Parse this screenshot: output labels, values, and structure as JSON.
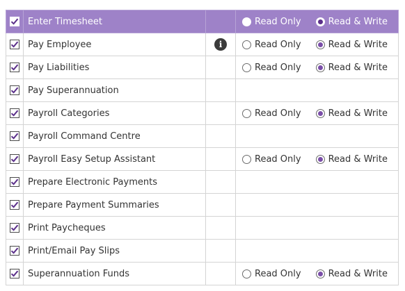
{
  "header": {
    "label": "Enter Timesheet",
    "option_read_only": "Read Only",
    "option_read_write": "Read & Write"
  },
  "info_icon_glyph": "i",
  "rows": [
    {
      "label": "Pay Employee",
      "read_only": "Read Only",
      "read_write": "Read & Write"
    },
    {
      "label": "Pay Liabilities",
      "read_only": "Read Only",
      "read_write": "Read & Write"
    },
    {
      "label": "Pay Superannuation"
    },
    {
      "label": "Payroll Categories",
      "read_only": "Read Only",
      "read_write": "Read & Write"
    },
    {
      "label": "Payroll Command Centre"
    },
    {
      "label": "Payroll Easy Setup Assistant",
      "read_only": "Read Only",
      "read_write": "Read & Write"
    },
    {
      "label": "Prepare Electronic Payments"
    },
    {
      "label": "Prepare Payment Summaries"
    },
    {
      "label": "Print Paycheques"
    },
    {
      "label": "Print/Email Pay Slips"
    },
    {
      "label": "Superannuation Funds",
      "read_only": "Read Only",
      "read_write": "Read & Write"
    }
  ],
  "colors": {
    "header_bg": "#9e82c8",
    "radio_selected": "#7a4ea8",
    "border": "#d4d4d4"
  }
}
